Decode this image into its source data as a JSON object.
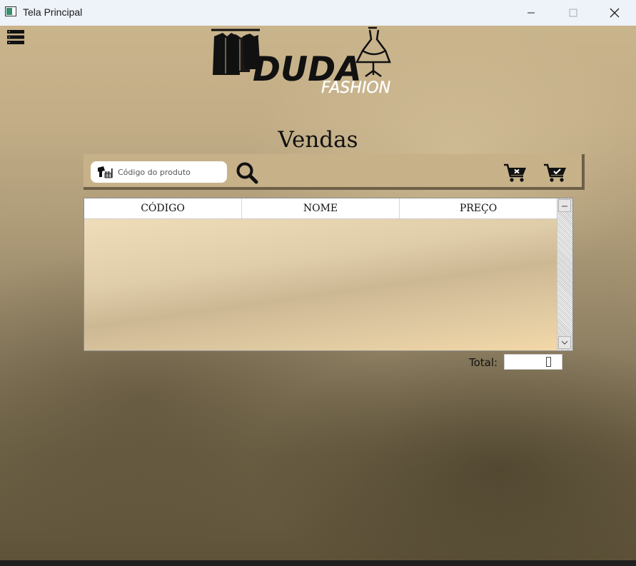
{
  "window": {
    "title": "Tela Principal",
    "controls": [
      "minimize-icon",
      "maximize-icon",
      "close-icon"
    ]
  },
  "header": {
    "menu_icon": "hamburger-list-icon",
    "logo": {
      "brand": "DUDA",
      "tagline": "FASHION"
    }
  },
  "page": {
    "title": "Vendas"
  },
  "toolbar": {
    "search_placeholder": "Código do produto",
    "search_value": "",
    "icons": [
      "barcode-scanner-icon",
      "search-icon",
      "cart-remove-icon",
      "cart-confirm-icon"
    ]
  },
  "table": {
    "columns": [
      "CÓDIGO",
      "NOME",
      "PREÇO"
    ],
    "rows": []
  },
  "total": {
    "label": "Total:",
    "value": ""
  },
  "colors": {
    "toolbar_bg": "#c6b189",
    "toolbar_shadow": "#6e6048",
    "background_top": "#c9b48c",
    "background_bottom": "#5e5339"
  }
}
